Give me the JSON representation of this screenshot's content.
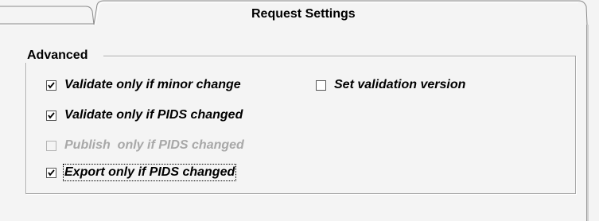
{
  "tab": {
    "title": "Request Settings"
  },
  "group": {
    "legend": "Advanced"
  },
  "checkboxes": [
    {
      "label": "Validate only if minor change",
      "checked": true,
      "enabled": true
    },
    {
      "label": "Set validation version",
      "checked": false,
      "enabled": true
    },
    {
      "label": "Validate only if PIDS changed",
      "checked": true,
      "enabled": true
    },
    {
      "label": "Publish  only if PIDS changed",
      "checked": false,
      "enabled": false
    },
    {
      "label": "Export only if PIDS changed",
      "checked": true,
      "enabled": true,
      "focused": true
    }
  ]
}
